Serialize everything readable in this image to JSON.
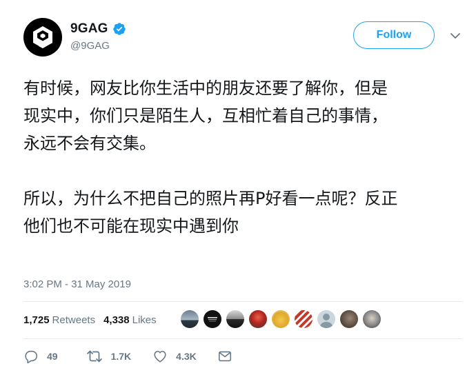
{
  "user": {
    "name": "9GAG",
    "handle": "@9GAG",
    "verified": true,
    "avatar_icon": "9gag-logo"
  },
  "header": {
    "follow_label": "Follow",
    "menu_icon": "chevron-down-icon"
  },
  "tweet": {
    "paragraphs": [
      "有时候，网友比你生活中的朋友还要了解你，但是\n现实中，你们只是陌生人，互相忙着自己的事情，\n永远不会有交集。",
      "所以，为什么不把自己的照片再P好看一点呢？反正\n他们也不可能在现实中遇到你"
    ],
    "timestamp": "3:02 PM - 31 May 2019"
  },
  "stats": {
    "retweets_count": "1,725",
    "retweets_label": "Retweets",
    "likes_count": "4,338",
    "likes_label": "Likes"
  },
  "actions": {
    "reply_count": "49",
    "retweet_count": "1.7K",
    "like_count": "4.3K"
  },
  "colors": {
    "accent": "#1da1f2",
    "secondary_text": "#657786",
    "divider": "#e6ecf0"
  }
}
